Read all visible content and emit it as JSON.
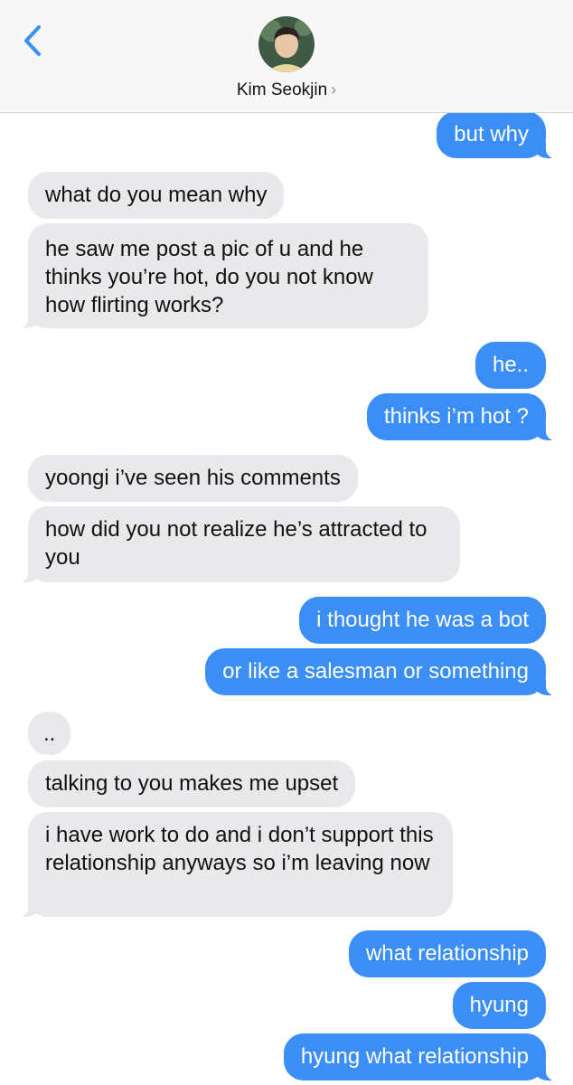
{
  "header": {
    "contact_name": "Kim Seokjin",
    "chevron": "›",
    "back_icon": "chevron-left-icon",
    "accent_color": "#3a8ef6",
    "received_color": "#e9e9eb"
  },
  "messages": [
    {
      "from": "me",
      "text": "but why"
    },
    {
      "from": "them",
      "text": "what do you mean why"
    },
    {
      "from": "them",
      "text": "he saw me post a pic of u and he thinks you’re hot, do you not know how flirting works?"
    },
    {
      "from": "me",
      "text": "he.."
    },
    {
      "from": "me",
      "text": "thinks i’m hot ?"
    },
    {
      "from": "them",
      "text": "yoongi i’ve seen his comments"
    },
    {
      "from": "them",
      "text": "how did you not realize he’s attracted to you"
    },
    {
      "from": "me",
      "text": "i thought he was a bot"
    },
    {
      "from": "me",
      "text": "or like a salesman or something"
    },
    {
      "from": "them",
      "text": ".."
    },
    {
      "from": "them",
      "text": "talking to you makes me upset"
    },
    {
      "from": "them",
      "text": "i have work to do and i don’t support this relationship anyways so i’m leaving now"
    },
    {
      "from": "me",
      "text": "what relationship"
    },
    {
      "from": "me",
      "text": "hyung"
    },
    {
      "from": "me",
      "text": "hyung what relationship"
    }
  ]
}
